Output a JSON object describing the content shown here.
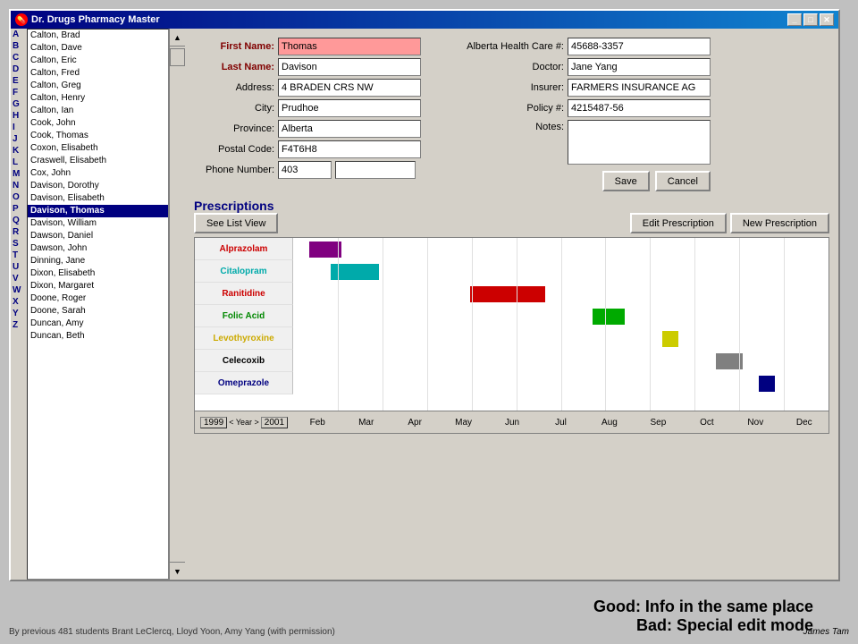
{
  "window": {
    "title": "Dr. Drugs Pharmacy Master"
  },
  "sidebar": {
    "letters": [
      "A",
      "B",
      "C",
      "D",
      "E",
      "F",
      "G",
      "H",
      "I",
      "J",
      "K",
      "L",
      "M",
      "N",
      "O",
      "P",
      "Q",
      "R",
      "S",
      "T",
      "U",
      "V",
      "W",
      "X",
      "Y",
      "Z"
    ],
    "patients": [
      {
        "name": "Calton, Brad",
        "bold": false
      },
      {
        "name": "Calton, Dave",
        "bold": false
      },
      {
        "name": "Calton, Eric",
        "bold": false
      },
      {
        "name": "Calton, Fred",
        "bold": false
      },
      {
        "name": "Calton, Greg",
        "bold": false
      },
      {
        "name": "Calton, Henry",
        "bold": false
      },
      {
        "name": "Calton, Ian",
        "bold": false
      },
      {
        "name": "Cook, John",
        "bold": false
      },
      {
        "name": "Cook, Thomas",
        "bold": false
      },
      {
        "name": "Coxon, Elisabeth",
        "bold": false
      },
      {
        "name": "Craswell, Elisabeth",
        "bold": false
      },
      {
        "name": "Cox, John",
        "bold": false
      },
      {
        "name": "Davison, Dorothy",
        "bold": false
      },
      {
        "name": "Davison, Elisabeth",
        "bold": false
      },
      {
        "name": "Davison, Thomas",
        "bold": true,
        "selected": true
      },
      {
        "name": "Davison, William",
        "bold": false
      },
      {
        "name": "Dawson, Daniel",
        "bold": false
      },
      {
        "name": "Dawson, John",
        "bold": false
      },
      {
        "name": "Dinning, Jane",
        "bold": false
      },
      {
        "name": "Dixon, Elisabeth",
        "bold": false
      },
      {
        "name": "Dixon, Margaret",
        "bold": false
      },
      {
        "name": "Doone, Roger",
        "bold": false
      },
      {
        "name": "Doone, Sarah",
        "bold": false
      },
      {
        "name": "Duncan, Amy",
        "bold": false
      },
      {
        "name": "Duncan, Beth",
        "bold": false
      }
    ]
  },
  "form": {
    "left": {
      "first_name_label": "First Name:",
      "last_name_label": "Last Name:",
      "address_label": "Address:",
      "city_label": "City:",
      "province_label": "Province:",
      "postal_code_label": "Postal Code:",
      "phone_label": "Phone Number:",
      "first_name_value": "Thomas",
      "last_name_value": "Davison",
      "address_value": "4 BRADEN CRS NW",
      "city_value": "Prudhoe",
      "province_value": "Alberta",
      "postal_code_value": "F4T6H8",
      "phone_value": "403"
    },
    "right": {
      "ahc_label": "Alberta Health Care #:",
      "doctor_label": "Doctor:",
      "insurer_label": "Insurer:",
      "policy_label": "Policy #:",
      "notes_label": "Notes:",
      "ahc_value": "45688-3357",
      "doctor_value": "Jane Yang",
      "insurer_value": "FARMERS INSURANCE AG",
      "policy_value": "4215487-56",
      "notes_value": ""
    }
  },
  "buttons": {
    "save": "Save",
    "cancel": "Cancel",
    "see_list_view": "See List View",
    "edit_prescription": "Edit Prescription",
    "new_prescription": "New Prescription"
  },
  "prescriptions": {
    "title": "Prescriptions",
    "drugs": [
      {
        "name": "Alprazolam",
        "color": "#800080"
      },
      {
        "name": "Citalopram",
        "color": "#00aaaa"
      },
      {
        "name": "Ranitidine",
        "color": "#cc0000"
      },
      {
        "name": "Folic Acid",
        "color": "#00aa00"
      },
      {
        "name": "Levothyroxine",
        "color": "#cccc00"
      },
      {
        "name": "Celecoxib",
        "color": "#808080"
      },
      {
        "name": "Omeprazole",
        "color": "#000080"
      }
    ],
    "label_colors": [
      "#cc0000",
      "#00aaaa",
      "#cc0000",
      "#008800",
      "#ccaa00",
      "#000000",
      "#000080"
    ],
    "bars": [
      {
        "drug_index": 0,
        "left_pct": 3,
        "width_pct": 6,
        "color": "#800080"
      },
      {
        "drug_index": 1,
        "left_pct": 7,
        "width_pct": 9,
        "color": "#00aaaa"
      },
      {
        "drug_index": 2,
        "left_pct": 33,
        "width_pct": 14,
        "color": "#cc0000"
      },
      {
        "drug_index": 3,
        "left_pct": 56,
        "width_pct": 6,
        "color": "#00aa00"
      },
      {
        "drug_index": 4,
        "left_pct": 69,
        "width_pct": 3,
        "color": "#cccc00"
      },
      {
        "drug_index": 5,
        "left_pct": 79,
        "width_pct": 5,
        "color": "#808080"
      },
      {
        "drug_index": 6,
        "left_pct": 87,
        "width_pct": 3,
        "color": "#000080"
      }
    ],
    "timeline": [
      "1999",
      "< Year >",
      "2001",
      "Feb",
      "Mar",
      "Apr",
      "May",
      "Jun",
      "Jul",
      "Aug",
      "Sep",
      "Oct",
      "Nov",
      "Dec"
    ]
  },
  "footer": {
    "good_text": "Good: Info in the same place",
    "bad_text": "Bad: Special edit mode",
    "attribution": "By previous 481 students Brant LeClercq, Lloyd Yoon, Amy Yang (with permission)",
    "author": "James Tam"
  }
}
